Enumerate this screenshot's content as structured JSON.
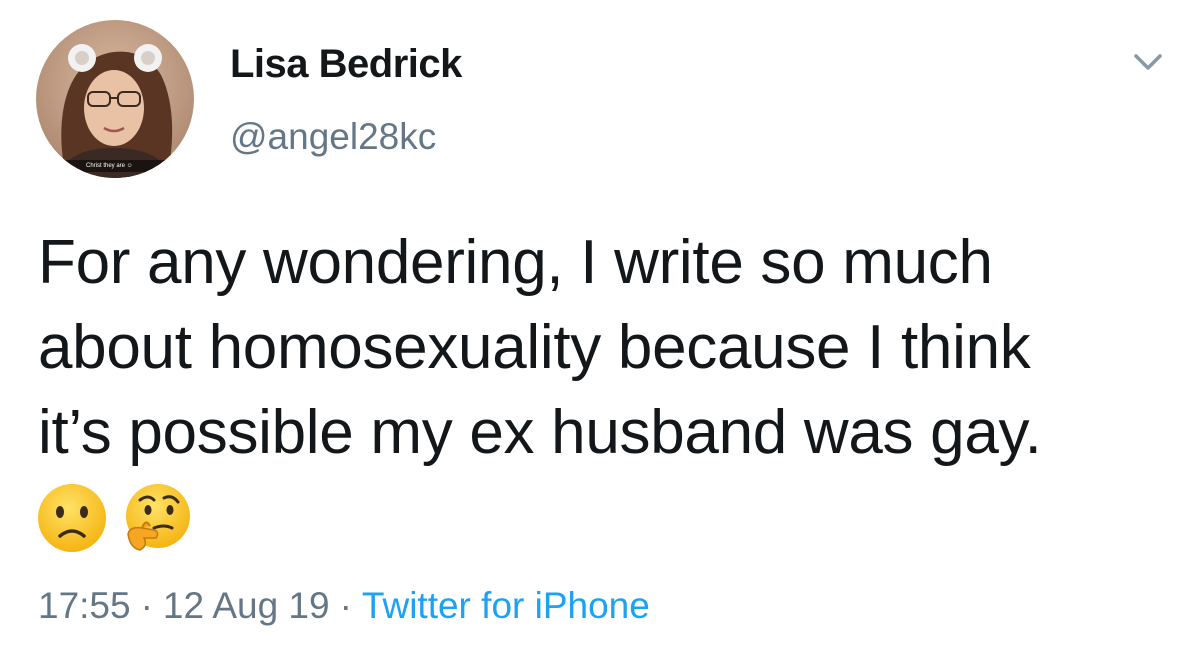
{
  "author": {
    "display_name": "Lisa Bedrick",
    "handle": "@angel28kc",
    "avatar_caption": "Christ they are ☺"
  },
  "tweet": {
    "lines": [
      "For any wondering, I write so much",
      "about homosexuality because I think",
      "it’s possible my ex husband was gay."
    ],
    "emojis": [
      "frowning-face",
      "thinking-face"
    ]
  },
  "meta": {
    "time": "17:55",
    "date": "12 Aug 19",
    "separator": "·",
    "source": "Twitter for iPhone"
  },
  "colors": {
    "text": "#14171a",
    "secondary": "#657786",
    "link": "#1da1f2",
    "caret": "#8899a6"
  }
}
